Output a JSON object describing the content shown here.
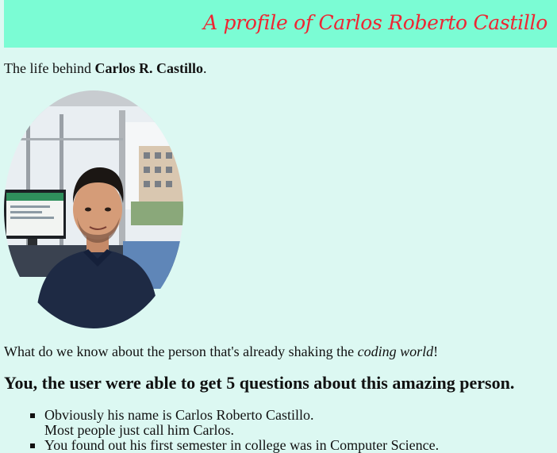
{
  "banner": {
    "title": "A profile of Carlos Roberto Castillo"
  },
  "intro": {
    "prefix": "The life behind ",
    "name": "Carlos R. Castillo",
    "suffix": "."
  },
  "portrait": {
    "alt": "Carlos Roberto Castillo"
  },
  "question": {
    "prefix": "What do we know about the person that's already shaking the ",
    "emphasis": "coding world",
    "suffix": "!"
  },
  "headline": "You, the user were able to get 5 questions about this amazing person.",
  "facts": [
    {
      "line1": "Obviously his name is Carlos Roberto Castillo.",
      "line2": "Most people just call him Carlos."
    },
    {
      "line1": "You found out his first semester in college was in Computer Science."
    }
  ],
  "colors": {
    "page_background": "#dcf8f2",
    "banner_background": "#7bfcd4",
    "banner_text": "#ee2633"
  }
}
